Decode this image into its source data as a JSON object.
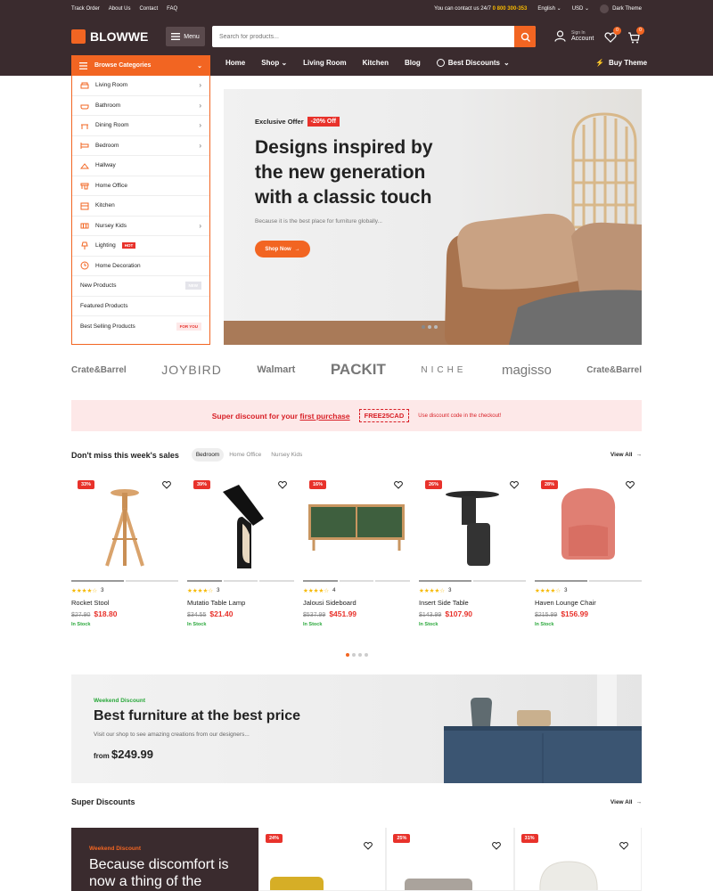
{
  "topbar": {
    "links": [
      "Track Order",
      "About Us",
      "Contact",
      "FAQ"
    ],
    "contact_text": "You can contact us 24/7",
    "phone": "0 800 300-353",
    "language": "English",
    "currency": "USD",
    "theme": "Dark Theme"
  },
  "header": {
    "logo": "BLOWWE",
    "menu_label": "Menu",
    "search_placeholder": "Search for products...",
    "account_top": "Sign In",
    "account_bottom": "Account",
    "wishlist_count": "0",
    "cart_count": "0"
  },
  "nav": {
    "browse": "Browse Categories",
    "items": [
      "Home",
      "Shop",
      "Living Room",
      "Kitchen",
      "Blog",
      "Best Discounts"
    ],
    "buy_theme": "Buy Theme"
  },
  "categories": [
    {
      "label": "Living Room",
      "icon": "sofa-icon",
      "chevron": true
    },
    {
      "label": "Bathroom",
      "icon": "bathtub-icon",
      "chevron": true
    },
    {
      "label": "Dining Room",
      "icon": "dining-table-icon",
      "chevron": true
    },
    {
      "label": "Bedroom",
      "icon": "bed-icon",
      "chevron": true
    },
    {
      "label": "Hallway",
      "icon": "coat-hanger-icon",
      "chevron": false
    },
    {
      "label": "Home Office",
      "icon": "desk-icon",
      "chevron": false
    },
    {
      "label": "Kitchen",
      "icon": "kitchen-icon",
      "chevron": false
    },
    {
      "label": "Nursey Kids",
      "icon": "crib-icon",
      "chevron": true
    },
    {
      "label": "Lighting",
      "icon": "lamp-icon",
      "badge": "HOT"
    },
    {
      "label": "Home Decoration",
      "icon": "clock-icon",
      "chevron": false
    }
  ],
  "extra_links": [
    {
      "label": "New Products",
      "tag": "NEW"
    },
    {
      "label": "Featured Products",
      "tag": ""
    },
    {
      "label": "Best Selling Products",
      "tag": "FOR YOU"
    }
  ],
  "hero": {
    "offer": "Exclusive Offer",
    "discount": "-20% Off",
    "title": "Designs inspired by the new generation with a classic touch",
    "subtitle": "Because it is the best place for furniture globally...",
    "button": "Shop Now"
  },
  "brands": [
    "Crate&Barrel",
    "JOYBIRD",
    "Walmart",
    "PACKIT",
    "NICHE",
    "magisso",
    "Crate&Barrel"
  ],
  "promo": {
    "text": "Super discount for your",
    "link": "first purchase",
    "code": "FREE25CAD",
    "note": "Use discount code in the checkout!"
  },
  "sales": {
    "title": "Don't miss this week's sales",
    "tabs": [
      "Bedroom",
      "Home Office",
      "Nursey Kids"
    ],
    "view_all": "View All",
    "products": [
      {
        "name": "Rocket Stool",
        "discount": "33%",
        "old_price": "$27.90",
        "price": "$18.80",
        "stars": 4,
        "reviews": "3",
        "stock": "In Stock"
      },
      {
        "name": "Mutatio Table Lamp",
        "discount": "39%",
        "old_price": "$34.55",
        "price": "$21.40",
        "stars": 4,
        "reviews": "3",
        "stock": "In Stock"
      },
      {
        "name": "Jalousi Sideboard",
        "discount": "16%",
        "old_price": "$537.99",
        "price": "$451.99",
        "stars": 4,
        "reviews": "4",
        "stock": "In Stock"
      },
      {
        "name": "Insert Side Table",
        "discount": "26%",
        "old_price": "$143.99",
        "price": "$107.90",
        "stars": 4,
        "reviews": "3",
        "stock": "In Stock"
      },
      {
        "name": "Haven Lounge Chair",
        "discount": "28%",
        "old_price": "$215.99",
        "price": "$156.99",
        "stars": 4,
        "reviews": "3",
        "stock": "In Stock"
      }
    ]
  },
  "weekend": {
    "label": "Weekend Discount",
    "title": "Best furniture at the best price",
    "desc": "Visit our shop to see amazing creations from our designers...",
    "from": "from",
    "price": "$249.99"
  },
  "super": {
    "title": "Super Discounts",
    "view_all": "View All",
    "banner_label": "Weekend Discount",
    "banner_title": "Because discomfort is now a thing of the",
    "discounts": [
      "24%",
      "25%",
      "31%"
    ]
  },
  "colors": {
    "accent": "#f26522",
    "dark": "#3a2b2e",
    "sale": "#e8322b",
    "stock": "#2aa83b"
  }
}
